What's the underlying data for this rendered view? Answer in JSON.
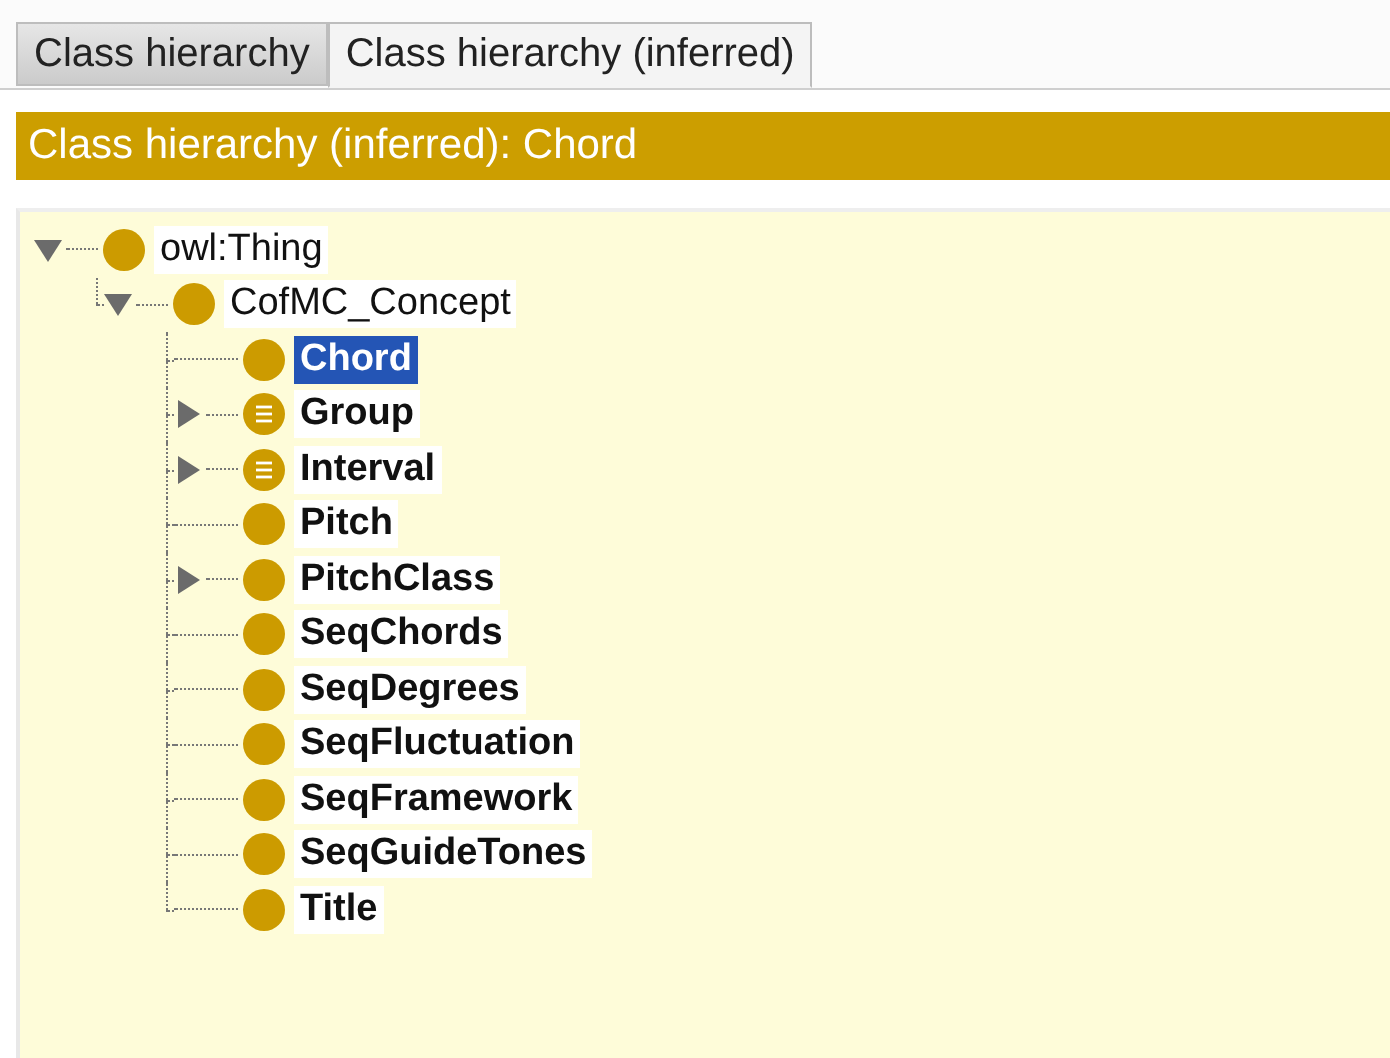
{
  "tabs": [
    {
      "label": "Class hierarchy",
      "selected": false
    },
    {
      "label": "Class hierarchy (inferred)",
      "selected": true
    }
  ],
  "header": {
    "title": "Class hierarchy (inferred): Chord"
  },
  "tree": [
    {
      "label": "owl:Thing",
      "kind": "class",
      "bold": false,
      "selected": false,
      "expanded": true,
      "children": [
        {
          "label": "CofMC_Concept",
          "kind": "class",
          "bold": false,
          "selected": false,
          "expanded": true,
          "children": [
            {
              "label": "Chord",
              "kind": "class",
              "bold": true,
              "selected": true
            },
            {
              "label": "Group",
              "kind": "defined",
              "bold": true,
              "selected": false,
              "expanded": false
            },
            {
              "label": "Interval",
              "kind": "defined",
              "bold": true,
              "selected": false,
              "expanded": false
            },
            {
              "label": "Pitch",
              "kind": "class",
              "bold": true,
              "selected": false
            },
            {
              "label": "PitchClass",
              "kind": "class",
              "bold": true,
              "selected": false,
              "expanded": false
            },
            {
              "label": "SeqChords",
              "kind": "class",
              "bold": true,
              "selected": false
            },
            {
              "label": "SeqDegrees",
              "kind": "class",
              "bold": true,
              "selected": false
            },
            {
              "label": "SeqFluctuation",
              "kind": "class",
              "bold": true,
              "selected": false
            },
            {
              "label": "SeqFramework",
              "kind": "class",
              "bold": true,
              "selected": false
            },
            {
              "label": "SeqGuideTones",
              "kind": "class",
              "bold": true,
              "selected": false
            },
            {
              "label": "Title",
              "kind": "class",
              "bold": true,
              "selected": false
            }
          ]
        }
      ]
    }
  ]
}
